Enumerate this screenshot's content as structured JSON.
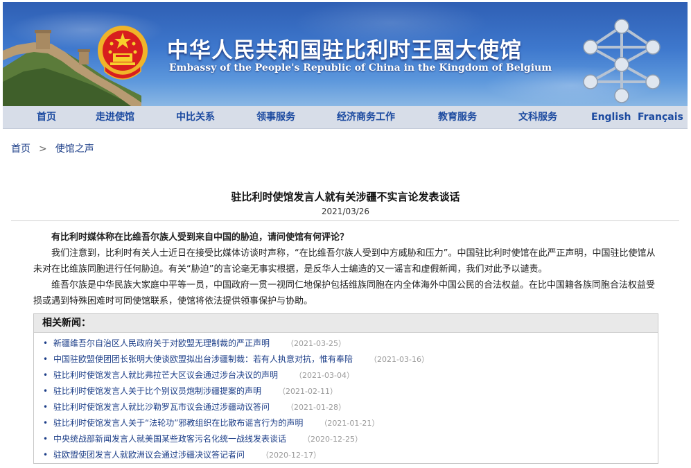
{
  "header": {
    "title_cn": "中华人民共和国驻比利时王国大使馆",
    "title_en": "Embassy of the People's Republic of China in the Kingdom of Belgium"
  },
  "nav": {
    "items": [
      "首页",
      "走进使馆",
      "中比关系",
      "领事服务",
      "经济商务工作",
      "教育服务",
      "文科服务",
      "English",
      "Français"
    ]
  },
  "breadcrumb": {
    "home": "首页",
    "sep": ">",
    "current": "使馆之声"
  },
  "article": {
    "title": "驻比利时使馆发言人就有关涉疆不实言论发表谈话",
    "date": "2021/03/26",
    "question": "有比利时媒体称在比维吾尔族人受到来自中国的胁迫，请问使馆有何评论？",
    "para1": "我们注意到，比利时有关人士近日在接受比媒体访谈时声称，“在比维吾尔族人受到中方威胁和压力”。中国驻比利时使馆在此严正声明，中国驻比使馆从未对在比维族同胞进行任何胁迫。有关“胁迫”的言论毫无事实根据，是反华人士编造的又一谣言和虚假新闻，我们对此予以谴责。",
    "para2": "维吾尔族是中华民族大家庭中平等一员，中国政府一贯一视同仁地保护包括维族同胞在内全体海外中国公民的合法权益。在比中国籍各族同胞合法权益受损或遇到特殊困难时可同使馆联系，使馆将依法提供领事保护与协助。"
  },
  "related": {
    "heading": "相关新闻：",
    "items": [
      {
        "title": "新疆维吾尔自治区人民政府关于对欧盟无理制裁的严正声明",
        "date": "（2021-03-25）"
      },
      {
        "title": "中国驻欧盟使团团长张明大使谈欧盟拟出台涉疆制裁：若有人执意对抗，惟有奉陪",
        "date": "（2021-03-16）"
      },
      {
        "title": "驻比利时使馆发言人就比弗拉芒大区议会通过涉台决议的声明",
        "date": "（2021-03-04）"
      },
      {
        "title": "驻比利时使馆发言人关于比个别议员炮制涉疆提案的声明",
        "date": "（2021-02-11）"
      },
      {
        "title": "驻比利时使馆发言人就比沙勒罗瓦市议会通过涉疆动议答问",
        "date": "（2021-01-28）"
      },
      {
        "title": "驻比利时使馆发言人关于“法轮功”邪教组织在比散布谣言行为的声明",
        "date": "（2021-01-21）"
      },
      {
        "title": "中央统战部新闻发言人就美国某些政客污名化统一战线发表谈话",
        "date": "（2020-12-25）"
      },
      {
        "title": "驻欧盟使团发言人就欧洲议会通过涉疆决议答记者问",
        "date": "（2020-12-17）"
      }
    ]
  },
  "colors": {
    "nav_bg": "#d7dde8",
    "nav_text": "#1c4aa0",
    "link": "#1c3e88",
    "banner_sky": "#3e78cd"
  }
}
